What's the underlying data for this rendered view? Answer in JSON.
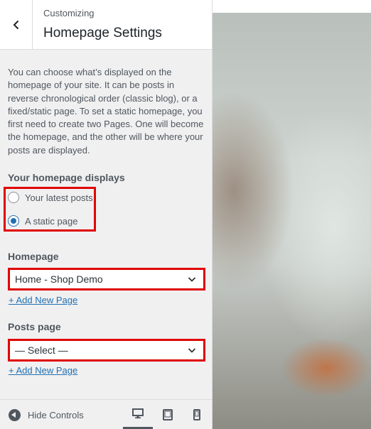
{
  "header": {
    "breadcrumb": "Customizing",
    "title": "Homepage Settings"
  },
  "description": "You can choose what’s displayed on the homepage of your site. It can be posts in reverse chronological order (classic blog), or a fixed/static page. To set a static homepage, you first need to create two Pages. One will become the homepage, and the other will be where your posts are displayed.",
  "homepage_displays": {
    "label": "Your homepage displays",
    "options": [
      {
        "label": "Your latest posts",
        "checked": false
      },
      {
        "label": "A static page",
        "checked": true
      }
    ]
  },
  "homepage": {
    "label": "Homepage",
    "selected": "Home - Shop Demo",
    "add_link": "+ Add New Page"
  },
  "posts_page": {
    "label": "Posts page",
    "selected": "— Select —",
    "add_link": "+ Add New Page"
  },
  "footer": {
    "hide_controls": "Hide Controls",
    "devices": [
      "desktop-icon",
      "tablet-icon",
      "mobile-icon"
    ],
    "active_device": "desktop-icon"
  },
  "colors": {
    "highlight": "#e00000",
    "link": "#2271b1",
    "radio_checked": "#2271b1"
  }
}
